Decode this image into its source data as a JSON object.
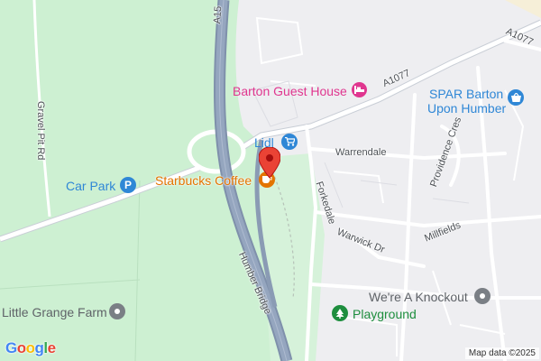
{
  "map": {
    "attribution": "Map data ©2025",
    "logo_text": "Google",
    "logo_letters": [
      "G",
      "o",
      "o",
      "g",
      "l",
      "e"
    ],
    "logo_colors": [
      "#4285F4",
      "#EA4335",
      "#FBBC05",
      "#4285F4",
      "#34A853",
      "#EA4335"
    ],
    "roads": {
      "a15": "A15",
      "a1077_ne": "A1077",
      "a1077": "A1077",
      "gravel_pit_rd": "Gravel Pit Rd",
      "warrendale": "Warrendale",
      "forkedale": "Forkedale",
      "providence_cres": "Providence Cres",
      "millfields": "Millfields",
      "warwick_dr": "Warwick Dr",
      "humber_bridge": "Humber Bridge"
    },
    "places": {
      "barton_guest_house": "Barton Guest House",
      "spar_line1": "SPAR Barton",
      "spar_line2": "Upon Humber",
      "lidl": "Lidl",
      "car_park": "Car Park",
      "starbucks": "Starbucks Coffee",
      "knockout": "We're A Knockout",
      "playground": "Playground",
      "little_grange_farm": "Little Grange Farm"
    },
    "icons": {
      "guest_house": "bed-icon",
      "spar": "shopping-basket-icon",
      "lidl": "shopping-cart-icon",
      "car_park": "parking-icon",
      "starbucks": "coffee-icon",
      "knockout": "generic-poi-icon",
      "playground": "tree-icon",
      "little_grange_farm": "generic-poi-icon",
      "marker": "location-pin-icon"
    },
    "colors": {
      "green_area": "#cdf0d2",
      "land": "#eeeef1",
      "motorway": "#8a9bb4",
      "road_white": "#ffffff",
      "lodging_pink": "#e0368f",
      "shop_blue": "#2f87d6",
      "food_orange": "#e37400",
      "park_green": "#1e8e3e",
      "poi_gray": "#5f6368",
      "marker_red": "#ea4335"
    }
  }
}
